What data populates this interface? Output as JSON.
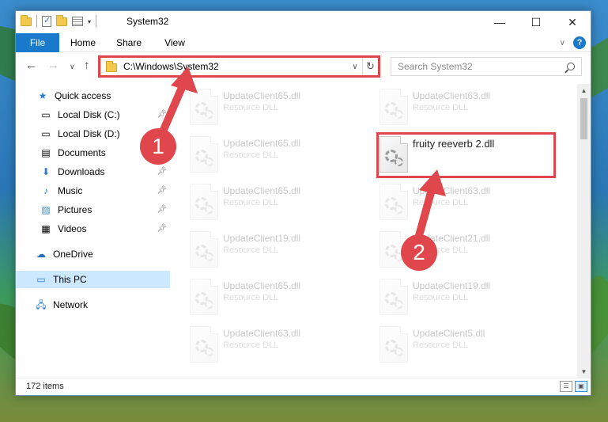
{
  "window": {
    "title": "System32",
    "controls": {
      "minimize": "—",
      "maximize": "☐",
      "close": "✕"
    }
  },
  "ribbon": {
    "tabs": [
      "File",
      "Home",
      "Share",
      "View"
    ],
    "help": "?"
  },
  "navigation": {
    "address": "C:\\Windows\\System32",
    "search_placeholder": "Search System32"
  },
  "sidebar": {
    "items": [
      {
        "label": "Quick access",
        "icon": "star-icon"
      },
      {
        "label": "Local Disk (C:)",
        "icon": "drive-icon"
      },
      {
        "label": "Local Disk (D:)",
        "icon": "drive-icon"
      },
      {
        "label": "Documents",
        "icon": "documents-icon"
      },
      {
        "label": "Downloads",
        "icon": "downloads-icon"
      },
      {
        "label": "Music",
        "icon": "music-icon"
      },
      {
        "label": "Pictures",
        "icon": "pictures-icon"
      },
      {
        "label": "Videos",
        "icon": "videos-icon"
      },
      {
        "label": "OneDrive",
        "icon": "onedrive-icon"
      },
      {
        "label": "This PC",
        "icon": "pc-icon",
        "selected": true
      },
      {
        "label": "Network",
        "icon": "network-icon"
      }
    ]
  },
  "files": [
    {
      "name": "UpdateClient65.dll",
      "type": "Resource DLL"
    },
    {
      "name": "UpdateClient63.dll",
      "type": "Resource DLL"
    },
    {
      "name": "UpdateClient65.dll",
      "type": "Resource DLL"
    },
    {
      "name": "fruity reeverb 2.dll",
      "type": ""
    },
    {
      "name": "UpdateClient65.dll",
      "type": "Resource DLL"
    },
    {
      "name": "UpdateClient63.dll",
      "type": "Resource DLL"
    },
    {
      "name": "UpdateClient19.dll",
      "type": "Resource DLL"
    },
    {
      "name": "UpdateClient21.dll",
      "type": "Resource DLL"
    },
    {
      "name": "UpdateClient65.dll",
      "type": "Resource DLL"
    },
    {
      "name": "UpdateClient19.dll",
      "type": "Resource DLL"
    },
    {
      "name": "UpdateClient63.dll",
      "type": "Resource DLL"
    },
    {
      "name": "UpdateClient5.dll",
      "type": "Resource DLL"
    }
  ],
  "status": {
    "item_count": "172 items"
  },
  "annotations": {
    "badge1": "1",
    "badge2": "2",
    "color": "#e0474c"
  }
}
